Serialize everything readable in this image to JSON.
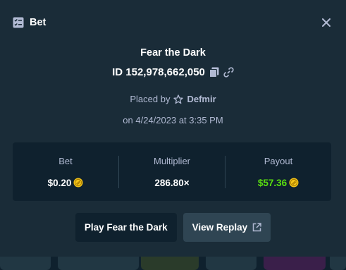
{
  "header": {
    "title": "Bet",
    "icon": "bet-list-icon",
    "close_icon": "close-icon"
  },
  "game": {
    "title": "Fear the Dark"
  },
  "bet_id": {
    "text": "ID 152,978,662,050"
  },
  "placed": {
    "prefix": "Placed by",
    "user": "Defmir"
  },
  "date": {
    "text": "on 4/24/2023 at 3:35 PM"
  },
  "stats": {
    "bet": {
      "label": "Bet",
      "value": "$0.20"
    },
    "multiplier": {
      "label": "Multiplier",
      "value": "286.80×"
    },
    "payout": {
      "label": "Payout",
      "value": "$57.36"
    }
  },
  "actions": {
    "play_label": "Play Fear the Dark",
    "replay_label": "View Replay"
  },
  "colors": {
    "background": "#1a2c38",
    "panel": "#0f212e",
    "payout_green": "#5ae00f",
    "coin_yellow": "#f5c518"
  }
}
